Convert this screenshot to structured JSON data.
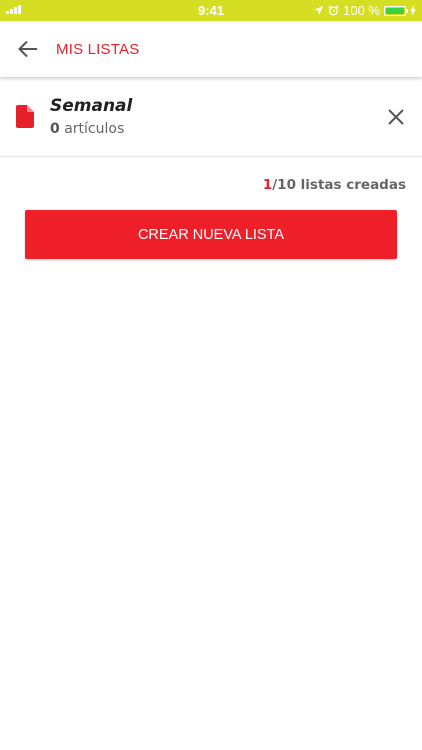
{
  "status_bar": {
    "time": "9:41",
    "battery_label": "100 %",
    "battery_level": 1.0,
    "icons": [
      "signal-icon",
      "location-icon",
      "alarm-icon",
      "battery-icon",
      "charging-icon"
    ]
  },
  "header": {
    "title": "MIS LISTAS",
    "back_icon": "arrow-left-icon"
  },
  "lists": [
    {
      "name": "Semanal",
      "count": "0",
      "count_suffix": " artículos"
    }
  ],
  "counter": {
    "current": "1",
    "rest": "/10 listas creadas"
  },
  "create_button": {
    "label": "CREAR NUEVA LISTA"
  },
  "colors": {
    "accent": "#e8202a",
    "status_bar": "#d6de23",
    "battery": "#3bd23d"
  }
}
